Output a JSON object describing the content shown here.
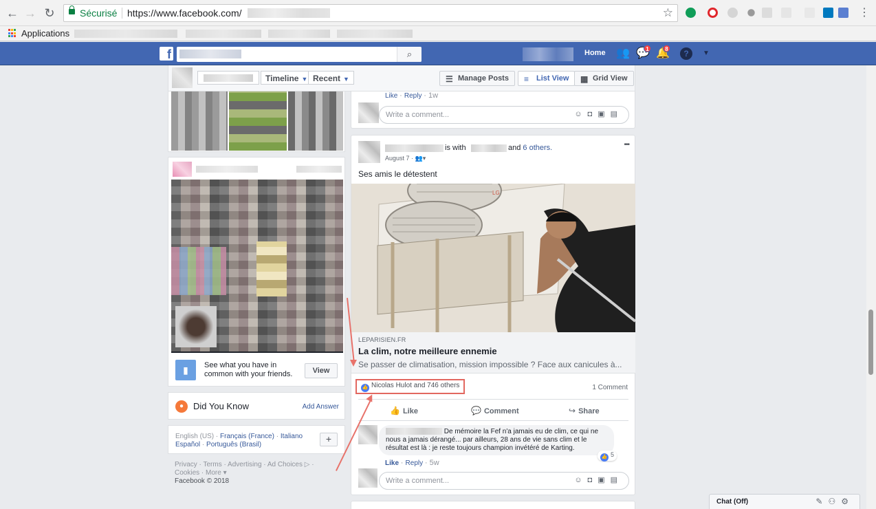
{
  "browser": {
    "secure_label": "Sécurisé",
    "url": "https://www.facebook.com/",
    "bookmarks_apps_label": "Applications"
  },
  "fb_header": {
    "home_label": "Home",
    "messages_badge": "1",
    "notifications_badge": "8"
  },
  "timeline_header": {
    "timeline_label": "Timeline",
    "recent_label": "Recent",
    "manage_posts_label": "Manage Posts",
    "list_view_label": "List View",
    "grid_view_label": "Grid View"
  },
  "left_column": {
    "friends_hint_text": "See what you have in common with your friends.",
    "view_button_label": "View",
    "did_you_know_title": "Did You Know",
    "add_answer_label": "Add Answer",
    "languages": {
      "current": "English (US)",
      "others": [
        "Français (France)",
        "Italiano",
        "Español",
        "Português (Brasil)"
      ],
      "add_label": "+"
    },
    "footer_links": "Privacy · Terms · Advertising · Ad Choices ▷ · Cookies · More ▾",
    "copyright": "Facebook © 2018"
  },
  "feed": {
    "prev_post": {
      "like_label": "Like",
      "reply_label": "Reply",
      "age": "1w",
      "comment_placeholder": "Write a comment..."
    },
    "post": {
      "with_text": "is with",
      "and_text": "and",
      "others_link": "6 others.",
      "date": "August 7 ·",
      "more_label": "•••",
      "text": "Ses amis le détestent",
      "link": {
        "domain": "LEPARISIEN.FR",
        "title": "La clim, notre meilleure ennemie",
        "description": "Se passer de climatisation, mission impossible ? Face aux canicules à..."
      },
      "reactions_text": "Nicolas Hulot and 746 others",
      "comment_count": "1 Comment",
      "actions": {
        "like": "Like",
        "comment": "Comment",
        "share": "Share"
      },
      "comment": {
        "text": "De mémoire la Fef n'a jamais eu de clim, ce qui ne nous a jamais dérangé... par ailleurs, 28 ans de vie sans clim et le résultat est là : je reste toujours champion invétéré de Karting.",
        "like_label": "Like",
        "reply_label": "Reply",
        "age": "5w",
        "likes": "5"
      },
      "comment_placeholder": "Write a comment..."
    }
  },
  "chat": {
    "label": "Chat (Off)"
  },
  "colors": {
    "fb_blue": "#4267b2",
    "link_blue": "#365899",
    "annotation_red": "#e2675f",
    "secure_green": "#0b8043"
  }
}
